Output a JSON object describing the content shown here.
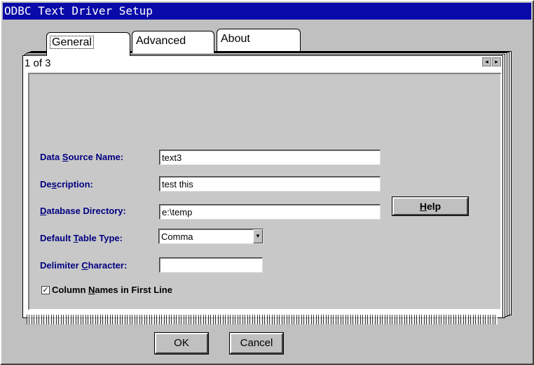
{
  "window": {
    "title": "ODBC Text Driver Setup"
  },
  "tabs": [
    {
      "label": "General",
      "active": true
    },
    {
      "label": "Advanced",
      "active": false
    },
    {
      "label": "About",
      "active": false
    }
  ],
  "page_info": "1 of 3",
  "form": {
    "data_source_name": {
      "label_pre": "Data ",
      "label_key": "S",
      "label_post": "ource Name:",
      "value": "text3"
    },
    "description": {
      "label_pre": "De",
      "label_key": "s",
      "label_post": "cription:",
      "value": "test this"
    },
    "database_directory": {
      "label_pre": "",
      "label_key": "D",
      "label_post": "atabase Directory:",
      "value": "e:\\temp"
    },
    "default_table_type": {
      "label_pre": "Default ",
      "label_key": "T",
      "label_post": "able Type:",
      "value": "Comma"
    },
    "delimiter_character": {
      "label_pre": "Delimiter ",
      "label_key": "C",
      "label_post": "haracter:",
      "value": ""
    },
    "column_names": {
      "label_pre": "Column ",
      "label_key": "N",
      "label_post": "ames in First Line",
      "checked": true,
      "check_glyph": "✓"
    }
  },
  "buttons": {
    "help": {
      "label_key": "H",
      "label_post": "elp"
    },
    "ok": "OK",
    "cancel": "Cancel"
  },
  "colors": {
    "titlebar": "#0a0aa8",
    "label": "#000080",
    "face": "#c0c0c0"
  }
}
